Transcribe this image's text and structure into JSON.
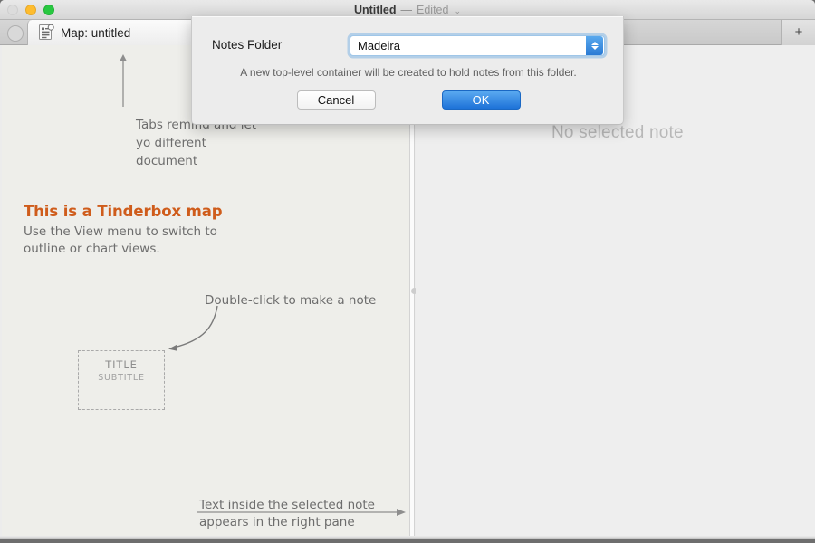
{
  "window": {
    "title": "Untitled",
    "title_separator": "—",
    "edited_label": "Edited",
    "chevron": "⌄",
    "traffic_lights": {
      "close": "close-button",
      "minimize": "minimize-button",
      "zoom": "zoom-button"
    }
  },
  "tabbar": {
    "tab_label": "Map: untitled",
    "tab_icon": "document-outline-icon",
    "new_tab_label": "+"
  },
  "map": {
    "tabs_hint": "Tabs remind and let yo different document",
    "heading_title": "This is a Tinderbox map",
    "heading_body": "Use the View menu to switch to outline or chart views.",
    "double_click_hint": "Double-click to make a note",
    "prototype": {
      "title": "TITLE",
      "subtitle": "SUBTITLE"
    },
    "bottom_hint": "Text inside the selected note appears in the right pane"
  },
  "text_pane": {
    "empty_message": "No selected note"
  },
  "dialog": {
    "label": "Notes Folder",
    "value": "Madeira",
    "description": "A new top-level container will be created to hold notes from this folder.",
    "cancel_label": "Cancel",
    "ok_label": "OK"
  },
  "colors": {
    "accent_blue": "#1d72d8",
    "heading_orange": "#cf5c1b",
    "map_background": "#eeeeea",
    "text_pane_background": "#eeeeee",
    "annotation_gray": "#6d6d6d"
  }
}
